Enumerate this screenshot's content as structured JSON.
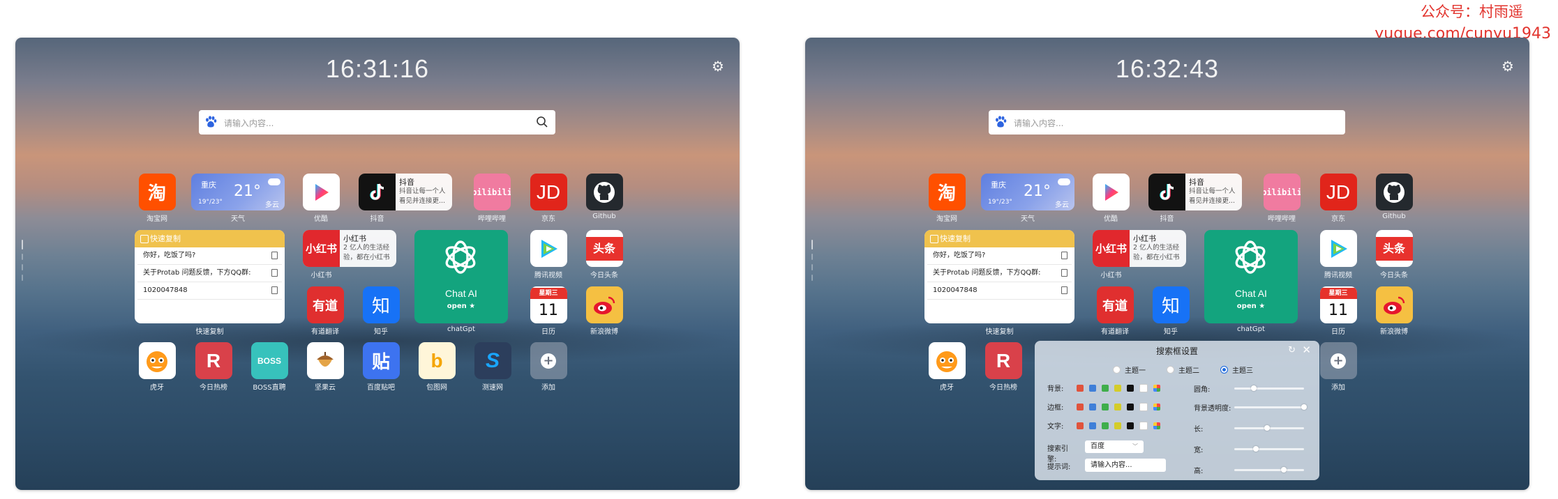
{
  "watermark": {
    "line1": "公众号：村雨遥",
    "line2": "yuque.com/cunyu1943"
  },
  "panels": [
    {
      "time": "16:31:16",
      "search_placeholder": "请输入内容...",
      "apps": {
        "taobao": {
          "icon": "淘",
          "label": "淘宝网"
        },
        "weather": {
          "city": "重庆",
          "temp": "21°",
          "range": "19°/23°",
          "cond": "多云",
          "label": "天气"
        },
        "youku": {
          "label": "优酷"
        },
        "douyin": {
          "title": "抖音",
          "desc": "抖音让每一个人看见并连接更...",
          "label": "抖音"
        },
        "bilibili": {
          "icon": "bilibili",
          "label": "哔哩哔哩"
        },
        "jd": {
          "icon": "JD",
          "label": "京东"
        },
        "github": {
          "label": "Github"
        },
        "quickcopy": {
          "title": "快速复制",
          "rows": [
            "你好，吃饭了吗?",
            "关于Protab 问题反馈，下方QQ群:",
            "1020047848"
          ],
          "label": "快速复制"
        },
        "xiaohongshu": {
          "icon": "小红书",
          "title": "小红书",
          "desc": "2 亿人的生活经验，都在小红书",
          "label": "小红书"
        },
        "chatgpt": {
          "title": "Chat AI",
          "open": "open ★",
          "label": "chatGpt"
        },
        "tencentvideo": {
          "label": "腾讯视频"
        },
        "toutiao": {
          "icon": "头条",
          "label": "今日头条"
        },
        "youdao": {
          "icon": "有道",
          "label": "有道翻译"
        },
        "zhihu": {
          "icon": "知",
          "label": "知乎"
        },
        "calendar": {
          "weekday": "星期三",
          "day": "11",
          "label": "日历"
        },
        "weibo": {
          "label": "新浪微博"
        },
        "huya": {
          "label": "虎牙"
        },
        "rebang": {
          "icon": "R",
          "label": "今日热榜"
        },
        "boss": {
          "icon": "BOSS",
          "label": "BOSS直聘"
        },
        "jianguoyun": {
          "label": "坚果云"
        },
        "tieba": {
          "icon": "贴",
          "label": "百度贴吧"
        },
        "baotu": {
          "icon": "b",
          "label": "包图网"
        },
        "cesu": {
          "icon": "S",
          "label": "测速网"
        },
        "add": {
          "icon": "+",
          "label": "添加"
        }
      }
    },
    {
      "time": "16:32:43",
      "search_placeholder": "请输入内容...",
      "apps": {
        "taobao": {
          "icon": "淘",
          "label": "淘宝网"
        },
        "weather": {
          "city": "重庆",
          "temp": "21°",
          "range": "19°/23°",
          "cond": "多云",
          "label": "天气"
        },
        "youku": {
          "label": "优酷"
        },
        "douyin": {
          "title": "抖音",
          "desc": "抖音让每一个人看见并连接更...",
          "label": "抖音"
        },
        "bilibili": {
          "icon": "bilibili",
          "label": "哔哩哔哩"
        },
        "jd": {
          "icon": "JD",
          "label": "京东"
        },
        "github": {
          "label": "Github"
        },
        "quickcopy": {
          "title": "快速复制",
          "rows": [
            "你好，吃饭了吗?",
            "关于Protab 问题反馈，下方QQ群:",
            "1020047848"
          ],
          "label": "快速复制"
        },
        "xiaohongshu": {
          "icon": "小红书",
          "title": "小红书",
          "desc": "2 亿人的生活经验，都在小红书",
          "label": "小红书"
        },
        "chatgpt": {
          "title": "Chat AI",
          "open": "open ★",
          "label": "chatGpt"
        },
        "tencentvideo": {
          "label": "腾讯视频"
        },
        "toutiao": {
          "icon": "头条",
          "label": "今日头条"
        },
        "youdao": {
          "icon": "有道",
          "label": "有道翻译"
        },
        "zhihu": {
          "icon": "知",
          "label": "知乎"
        },
        "calendar": {
          "weekday": "星期三",
          "day": "11",
          "label": "日历"
        },
        "weibo": {
          "label": "新浪微博"
        },
        "huya": {
          "label": "虎牙"
        },
        "rebang": {
          "icon": "R",
          "label": "今日热榜"
        },
        "add": {
          "icon": "+",
          "label": "添加"
        }
      },
      "search_settings": {
        "title": "搜索框设置",
        "themes": [
          {
            "label": "主题一",
            "selected": false
          },
          {
            "label": "主题二",
            "selected": false
          },
          {
            "label": "主题三",
            "selected": true
          }
        ],
        "color_rows": [
          {
            "label": "背景:"
          },
          {
            "label": "边框:"
          },
          {
            "label": "文字:"
          }
        ],
        "swatch_colors": [
          "#e0533c",
          "#3f7fd8",
          "#3fae4b",
          "#d4cc2a",
          "#111111",
          "#ffffff"
        ],
        "engine_label": "搜索引擎:",
        "engine_value": "百度",
        "hint_label": "提示词:",
        "hint_value": "请输入内容...",
        "sliders": [
          {
            "label": "圆角:",
            "value_pct": 25
          },
          {
            "label": "背景透明度:",
            "value_pct": 100
          },
          {
            "label": "长:",
            "value_pct": 45
          },
          {
            "label": "宽:",
            "value_pct": 28
          },
          {
            "label": "高:",
            "value_pct": 70
          }
        ]
      }
    }
  ],
  "colors": {
    "accent_blue": "#1f6bde",
    "chatgpt_green": "#13a47e",
    "copy_yellow": "#f0c24d"
  }
}
